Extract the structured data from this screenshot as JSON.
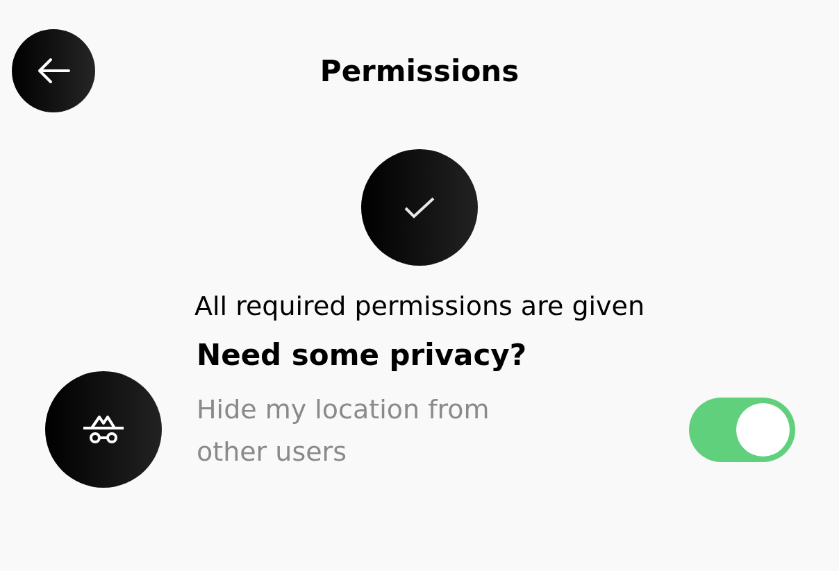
{
  "header": {
    "title": "Permissions"
  },
  "status": {
    "message": "All required permissions are given"
  },
  "privacy": {
    "title": "Need some privacy?",
    "description": "Hide my location from other users",
    "on": true
  }
}
